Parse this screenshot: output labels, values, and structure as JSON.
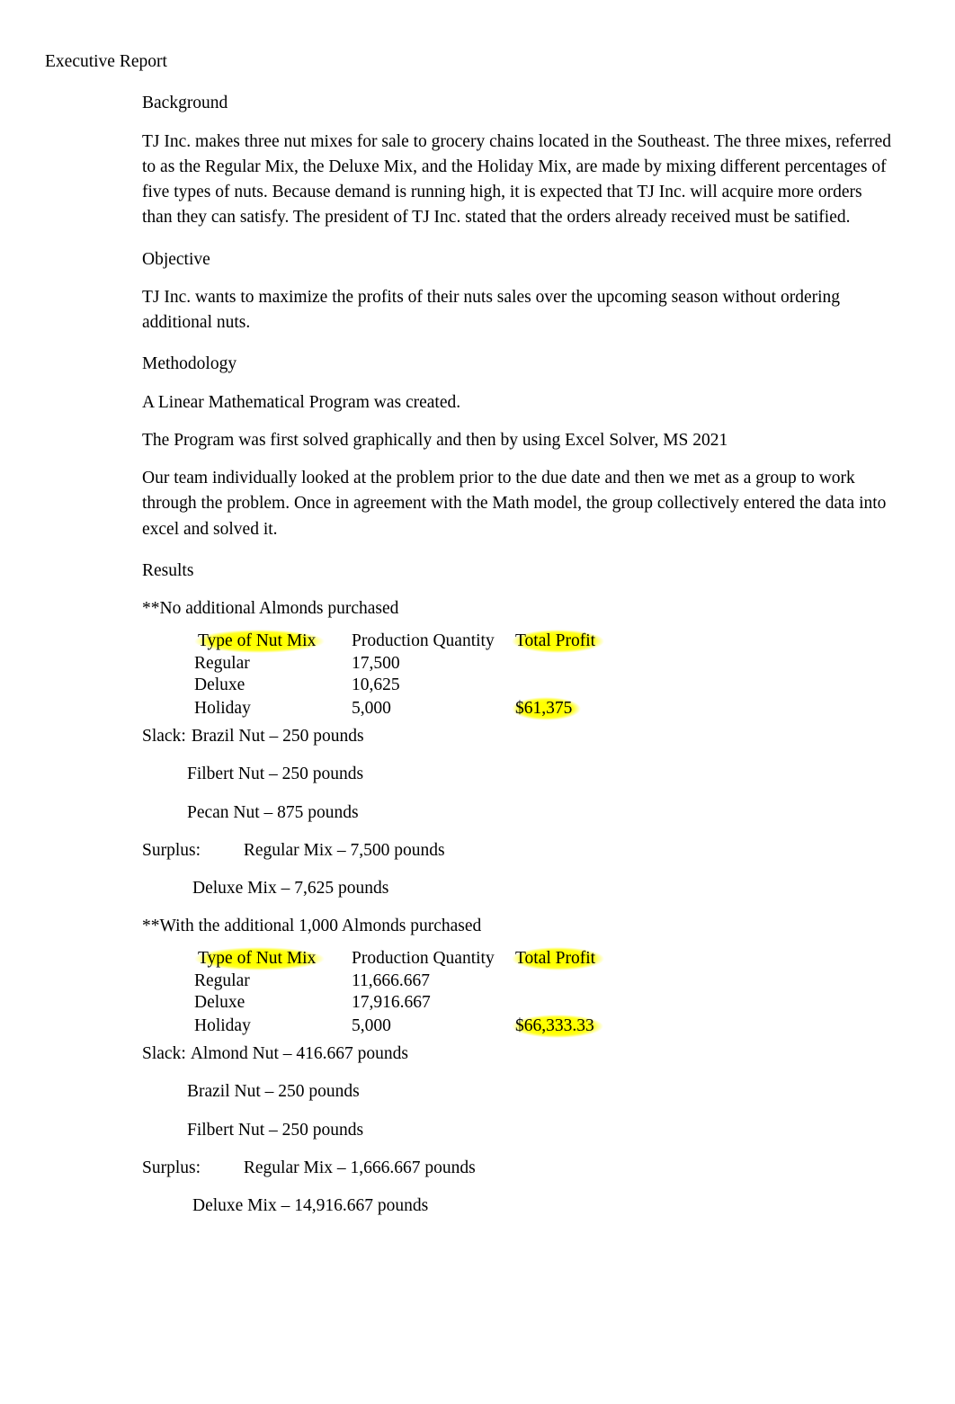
{
  "title": "Executive Report",
  "sections": {
    "background": {
      "h": "Background",
      "p": "TJ Inc. makes three nut mixes for sale to grocery chains located in the Southeast. The three mixes, referred to as the Regular Mix, the Deluxe Mix, and the Holiday Mix, are made by mixing different percentages of five types of nuts. Because demand is running high, it is expected that TJ Inc. will acquire more orders than they can satisfy. The president of TJ Inc. stated that the orders already received must be satified."
    },
    "objective": {
      "h": "Objective",
      "p": "TJ Inc. wants to maximize the profits of their nuts sales over the upcoming season without ordering additional nuts."
    },
    "methodology": {
      "h": "Methodology",
      "p1": "A Linear Mathematical Program was created.",
      "p2": "The Program was first solved graphically and then by using Excel Solver, MS 2021",
      "p3": "Our team individually looked at the problem prior to the due date and then we met as a group to work through the problem.   Once in agreement with the Math model, the group collectively entered the data into excel and solved it."
    },
    "results": {
      "h": "Results",
      "noAdd": "**No additional Almonds purchased",
      "withAdd": "**With the additional 1,000 Almonds purchased",
      "headers": {
        "c1": "Type of Nut Mix",
        "c2": "Production Quantity",
        "c3": "Total Profit"
      },
      "t1": {
        "rows": [
          {
            "c1": "Regular",
            "c2": "17,500",
            "c3": ""
          },
          {
            "c1": "Deluxe",
            "c2": "10,625",
            "c3": ""
          },
          {
            "c1": "Holiday",
            "c2": "5,000",
            "c3": "$61,375"
          }
        ]
      },
      "t2": {
        "rows": [
          {
            "c1": "Regular",
            "c2": "11,666.667",
            "c3": ""
          },
          {
            "c1": "Deluxe",
            "c2": "17,916.667",
            "c3": ""
          },
          {
            "c1": "Holiday",
            "c2": "5,000",
            "c3": "$66,333.33"
          }
        ]
      },
      "slack1": {
        "label": "Slack:",
        "items": [
          "Brazil Nut – 250 pounds",
          "Filbert Nut – 250 pounds",
          "Pecan Nut – 875 pounds"
        ]
      },
      "surplus1": {
        "label": "Surplus:",
        "items": [
          "Regular Mix – 7,500 pounds",
          "Deluxe Mix – 7,625 pounds"
        ]
      },
      "slack2": {
        "label": "Slack:",
        "items": [
          "Almond Nut – 416.667 pounds",
          "Brazil Nut – 250 pounds",
          "Filbert Nut – 250 pounds"
        ]
      },
      "surplus2": {
        "label": "Surplus:",
        "items": [
          "Regular Mix – 1,666.667 pounds",
          "Deluxe Mix – 14,916.667 pounds"
        ]
      }
    }
  }
}
